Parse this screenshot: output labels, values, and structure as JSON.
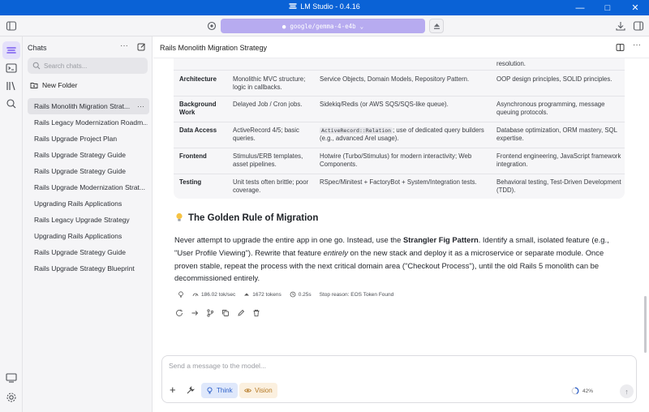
{
  "window": {
    "app_name": "LM Studio",
    "version": "0.4.16",
    "separator": "-"
  },
  "toolbar": {
    "model": "google/gemma-4-e4b"
  },
  "sidebar": {
    "heading": "Chats",
    "search_placeholder": "Search chats...",
    "new_folder": "New Folder",
    "chats": [
      {
        "label": "Rails Monolith Migration Strat...",
        "active": true
      },
      {
        "label": "Rails Legacy Modernization Roadm..."
      },
      {
        "label": "Rails Upgrade Project Plan"
      },
      {
        "label": "Rails Upgrade Strategy Guide"
      },
      {
        "label": "Rails Upgrade Strategy Guide"
      },
      {
        "label": "Rails Upgrade Modernization Strat..."
      },
      {
        "label": "Upgrading Rails Applications"
      },
      {
        "label": "Rails Legacy Upgrade Strategy"
      },
      {
        "label": "Upgrading Rails Applications"
      },
      {
        "label": "Rails Upgrade Strategy Guide"
      },
      {
        "label": "Rails Upgrade Strategy Blueprint"
      }
    ]
  },
  "main": {
    "title": "Rails Monolith Migration Strategy",
    "table": {
      "top_fragment": "resolution.",
      "rows": [
        {
          "aspect": "Architecture",
          "legacy": "Monolithic MVC structure; logic in callbacks.",
          "target": "Service Objects, Domain Models, Repository Pattern.",
          "skill": "OOP design principles, SOLID principles."
        },
        {
          "aspect": "Background Work",
          "legacy": "Delayed Job / Cron jobs.",
          "target": "Sidekiq/Redis (or AWS SQS/SQS-like queue).",
          "skill": "Asynchronous programming, message queuing protocols."
        },
        {
          "aspect": "Data Access",
          "legacy": "ActiveRecord 4/5; basic queries.",
          "target_code": "ActiveRecord::Relation",
          "target_rest": "; use of dedicated query builders (e.g., advanced Arel usage).",
          "skill": "Database optimization, ORM mastery, SQL expertise."
        },
        {
          "aspect": "Frontend",
          "legacy": "Stimulus/ERB templates, asset pipelines.",
          "target": "Hotwire (Turbo/Stimulus) for modern interactivity; Web Components.",
          "skill": "Frontend engineering, JavaScript framework integration."
        },
        {
          "aspect": "Testing",
          "legacy": "Unit tests often brittle; poor coverage.",
          "target": "RSpec/Minitest + FactoryBot + System/Integration tests.",
          "skill": "Behavioral testing, Test-Driven Development (TDD)."
        }
      ]
    },
    "section_heading": "The Golden Rule of Migration",
    "paragraph": {
      "p1": "Never attempt to upgrade the entire app in one go. Instead, use the ",
      "b1": "Strangler Fig Pattern",
      "p2": ". Identify a small, isolated feature (e.g., \"User Profile Viewing\"). Rewrite that feature ",
      "i1": "entirely",
      "p3": " on the new stack and deploy it as a microservice or separate module. Once proven stable, repeat the process with the next critical domain area (\"Checkout Process\"), until the old Rails 5 monolith can be decommissioned entirely."
    },
    "stats": {
      "speed": "186.02 tok/sec",
      "tokens": "1672 tokens",
      "time": "0.25s",
      "stop_reason": "Stop reason: EOS Token Found"
    }
  },
  "composer": {
    "placeholder": "Send a message to the model...",
    "think_label": "Think",
    "vision_label": "Vision",
    "context_usage": "42%"
  }
}
